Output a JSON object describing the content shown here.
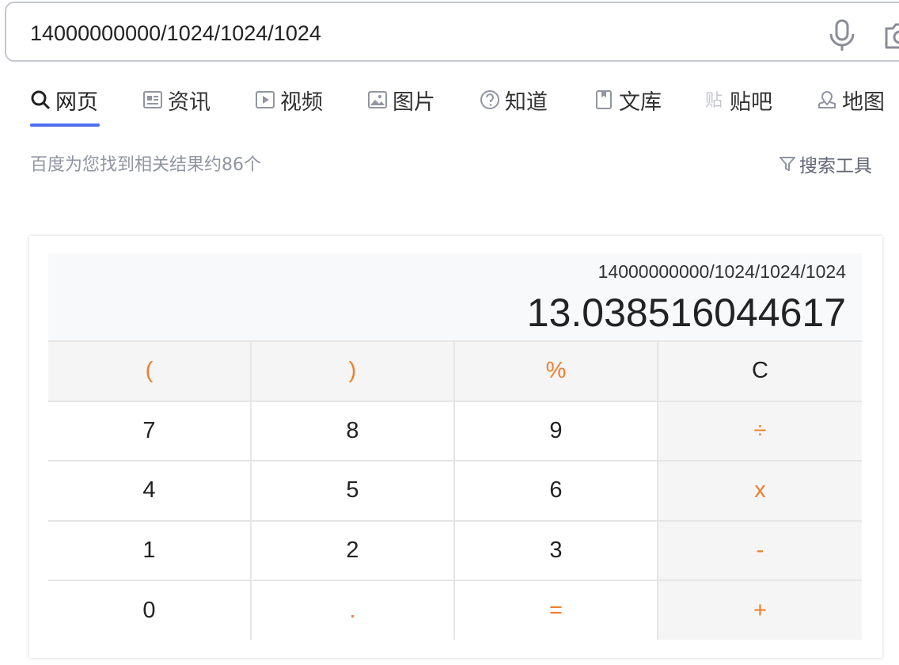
{
  "search": {
    "query": "14000000000/1024/1024/1024",
    "mic_icon": "microphone-icon",
    "camera_icon": "camera-icon"
  },
  "tabs": [
    {
      "label": "网页",
      "icon": "search-icon",
      "active": true
    },
    {
      "label": "资讯",
      "icon": "news-icon"
    },
    {
      "label": "视频",
      "icon": "video-icon"
    },
    {
      "label": "图片",
      "icon": "image-icon"
    },
    {
      "label": "知道",
      "icon": "question-icon"
    },
    {
      "label": "文库",
      "icon": "document-icon"
    },
    {
      "label": "贴吧",
      "icon": "tieba-icon"
    },
    {
      "label": "地图",
      "icon": "map-icon"
    }
  ],
  "results": {
    "count_text": "百度为您找到相关结果约86个",
    "tools_label": "搜索工具"
  },
  "calculator": {
    "expression": "14000000000/1024/1024/1024",
    "result": "13.038516044617",
    "keys": [
      [
        "(",
        ")",
        "%",
        "C"
      ],
      [
        "7",
        "8",
        "9",
        "÷"
      ],
      [
        "4",
        "5",
        "6",
        "x"
      ],
      [
        "1",
        "2",
        "3",
        "-"
      ],
      [
        "0",
        ".",
        "=",
        "+"
      ]
    ]
  },
  "colors": {
    "accent": "#4e6ef2",
    "operator": "#f07e2a",
    "muted_text": "#9195a3"
  }
}
